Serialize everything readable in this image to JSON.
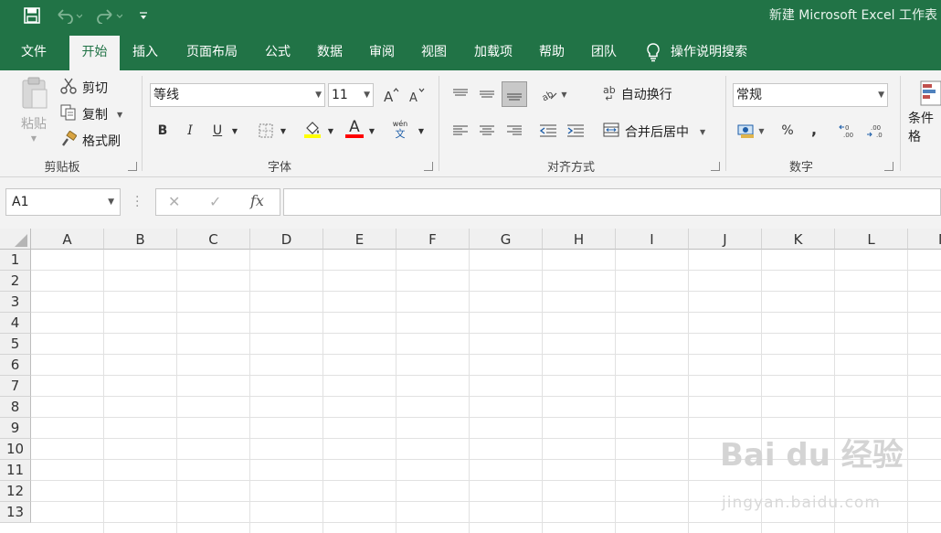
{
  "titlebar": {
    "title": "新建 Microsoft Excel 工作表",
    "qat": [
      "save-icon",
      "undo-icon",
      "redo-icon",
      "customize-icon"
    ]
  },
  "tabs": [
    {
      "label": "文件"
    },
    {
      "label": "开始",
      "active": true
    },
    {
      "label": "插入"
    },
    {
      "label": "页面布局"
    },
    {
      "label": "公式"
    },
    {
      "label": "数据"
    },
    {
      "label": "审阅"
    },
    {
      "label": "视图"
    },
    {
      "label": "加载项"
    },
    {
      "label": "帮助"
    },
    {
      "label": "团队"
    }
  ],
  "tellme": {
    "label": "操作说明搜索"
  },
  "clipboard": {
    "paste": "粘贴",
    "cut": "剪切",
    "copy": "复制",
    "format_painter": "格式刷",
    "group_label": "剪贴板"
  },
  "font": {
    "font_name": "等线",
    "font_size": "11",
    "group_label": "字体",
    "bold": "B",
    "italic": "I",
    "underline": "U",
    "font_color_letter": "A",
    "phonetic_top": "wén",
    "phonetic_bottom": "文"
  },
  "alignment": {
    "wrap_text": "自动换行",
    "merge_center": "合并后居中",
    "group_label": "对齐方式",
    "ab": "ab"
  },
  "number": {
    "format": "常规",
    "percent": "%",
    "comma": ",",
    "group_label": "数字"
  },
  "styles": {
    "conditional_formatting": "条件格"
  },
  "formula_bar": {
    "name_box": "A1",
    "cancel": "✕",
    "enter": "✓",
    "fx": "fx"
  },
  "columns": [
    "A",
    "B",
    "C",
    "D",
    "E",
    "F",
    "G",
    "H",
    "I",
    "J",
    "K",
    "L",
    "M"
  ],
  "rows": [
    "1",
    "2",
    "3",
    "4",
    "5",
    "6",
    "7",
    "8",
    "9",
    "10",
    "11",
    "12",
    "13"
  ],
  "watermark": {
    "main": "Bai du 经验",
    "sub": "jingyan.baidu.com"
  },
  "colors": {
    "excel_green": "#217346",
    "fill_yellow": "#ffff00",
    "font_red": "#ff0000"
  }
}
